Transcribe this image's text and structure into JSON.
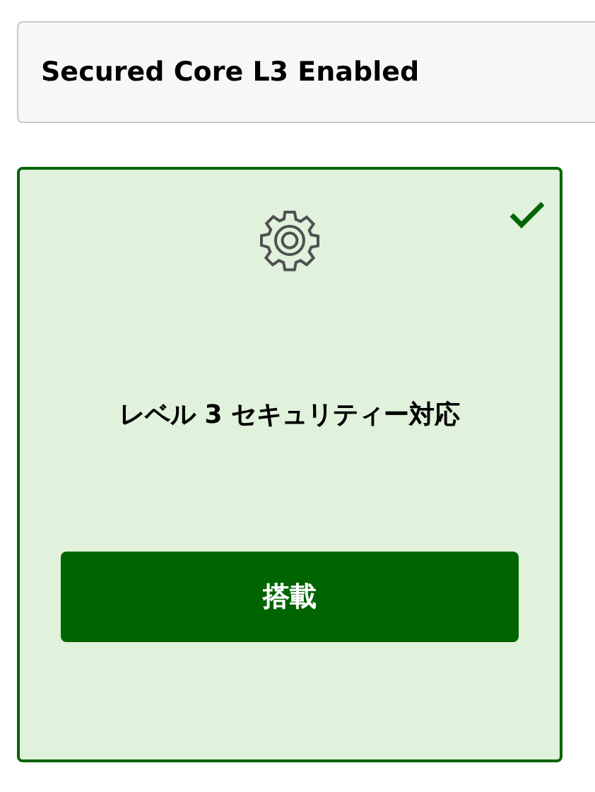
{
  "header": {
    "title": "Secured Core L3 Enabled"
  },
  "card": {
    "selected": true,
    "title": "レベル 3 セキュリティー対応",
    "button": "搭載"
  }
}
